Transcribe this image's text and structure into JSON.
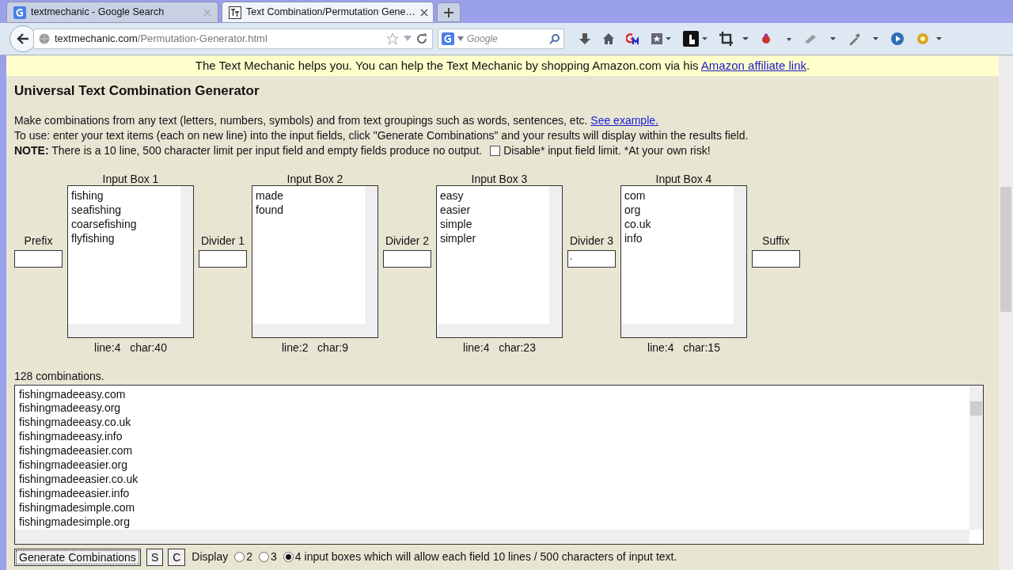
{
  "tabs": [
    {
      "label": "textmechanic - Google Search",
      "selected": false
    },
    {
      "label": "Text Combination/Permutation Gene…",
      "selected": true
    }
  ],
  "address": {
    "domain": "textmechanic.com",
    "path": "/Permutation-Generator.html"
  },
  "search": {
    "placeholder": "Google"
  },
  "banner": {
    "text": "The Text Mechanic helps you. You can help the Text Mechanic by shopping Amazon.com via his ",
    "link": "Amazon affiliate link",
    "tail": "."
  },
  "page_title": "Universal Text Combination Generator",
  "intro": {
    "line1": "Make combinations from any text (letters, numbers, symbols) and from text groupings such as words, sentences, etc.",
    "example_link": "See example.",
    "line2": "To use: enter your text items (each on new line) into the input fields, click \"Generate Combinations\" and your results will display within the results field.",
    "note": "**NOTE:** There is a 10 line, 500 character limit per input field and empty fields produce no output.",
    "disable_checked": false,
    "disable_label": "Disable* input field limit. *At your own risk!"
  },
  "fields": [
    {
      "kind": "small",
      "label": "Prefix"
    },
    {
      "kind": "box",
      "label": "Input Box 1",
      "lines": [
        "fishing",
        "seafishing",
        "coarsefishing",
        "flyfishing"
      ],
      "stats": "line:4   char:40"
    },
    {
      "kind": "small",
      "label": "Divider 1"
    },
    {
      "kind": "box",
      "label": "Input Box 2",
      "lines": [
        "made",
        "found"
      ],
      "stats": "line:2   char:9"
    },
    {
      "kind": "small",
      "label": "Divider 2"
    },
    {
      "kind": "box",
      "label": "Input Box 3",
      "lines": [
        "easy",
        "easier",
        "simple",
        "simpler"
      ],
      "stats": "line:4   char:23"
    },
    {
      "kind": "small",
      "label": "Divider 3",
      "value": "."
    },
    {
      "kind": "box",
      "label": "Input Box 4",
      "lines": [
        "com",
        "org",
        "co.uk",
        "info"
      ],
      "stats": "line:4   char:15"
    },
    {
      "kind": "small",
      "label": "Suffix"
    }
  ],
  "results": {
    "count": "128 combinations.",
    "lines": [
      "fishingmadeeasy.com",
      "fishingmadeeasy.org",
      "fishingmadeeasy.co.uk",
      "fishingmadeeasy.info",
      "fishingmadeeasier.com",
      "fishingmadeeasier.org",
      "fishingmadeeasier.co.uk",
      "fishingmadeeasier.info",
      "fishingmadesimple.com",
      "fishingmadesimple.org"
    ]
  },
  "controls": {
    "buttons": [
      "Generate Combinations",
      "S",
      "C"
    ],
    "display_label": "Display",
    "options": [
      {
        "label": "2",
        "selected": false
      },
      {
        "label": "3",
        "selected": false
      },
      {
        "label": "4 input boxes which will allow each field 10 lines / 500 characters of input text.",
        "selected": true
      }
    ]
  }
}
